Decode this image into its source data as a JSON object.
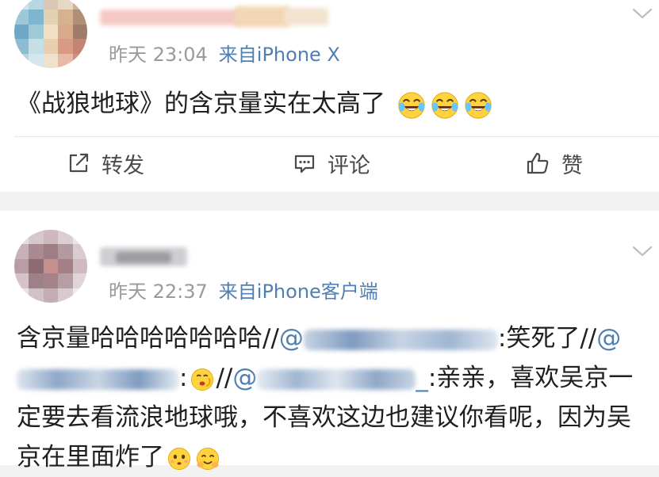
{
  "posts": [
    {
      "time": "昨天 23:04",
      "source": "来自iPhone X",
      "text": "《战狼地球》的含京量实在太高了",
      "actions": {
        "repost": "转发",
        "comment": "评论",
        "like": "赞"
      }
    },
    {
      "time": "昨天 22:37",
      "source": "来自iPhone客户端",
      "text_segments": {
        "s1": "含京量哈哈哈哈哈哈哈//",
        "m1": "@",
        "s2": ":笑死了//",
        "m2": "@",
        "s3": ":",
        "s4": "//",
        "m3": "@",
        "m3_tail": "_",
        "s5": ":亲亲，喜欢吴京一定要去看流浪地球哦，不喜欢这边也建议你看呢，因为吴京在里面炸了"
      }
    }
  ],
  "colors": {
    "link": "#4f7fb3",
    "meta": "#9a9a9a",
    "text": "#1f1f1f",
    "separator": "#f2f2f2"
  },
  "icons": {
    "repost": "share-box-icon",
    "comment": "comment-bubble-icon",
    "like": "thumbs-up-icon",
    "more": "chevron-down-icon",
    "emoji_laugh": "crying-laughing-emoji",
    "emoji_face": "face-emoji"
  }
}
